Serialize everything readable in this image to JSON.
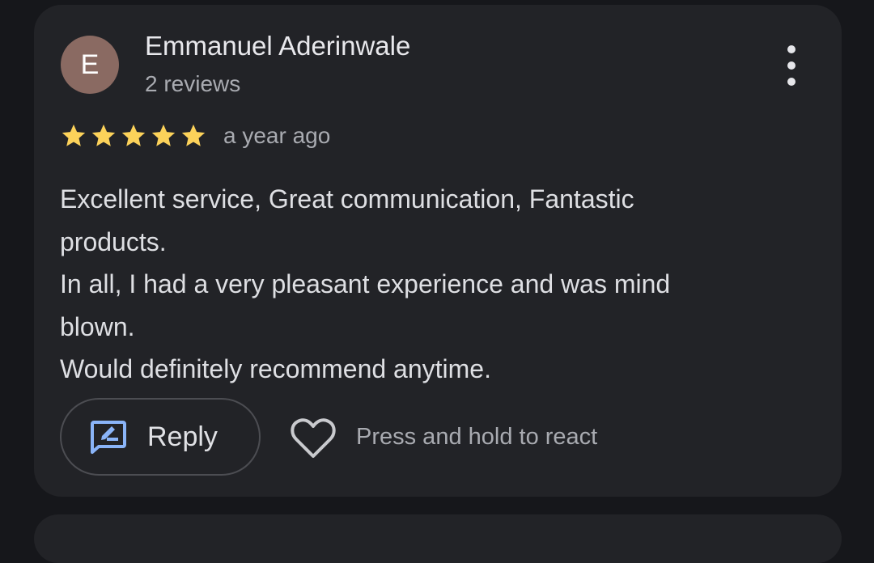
{
  "review": {
    "author_initial": "E",
    "author_name": "Emmanuel Aderinwale",
    "author_review_count": "2 reviews",
    "rating": 5,
    "rating_max": 5,
    "time_ago": "a year ago",
    "text_lines": [
      "Excellent service, Great communication, Fantastic products.",
      "In all, I had a very pleasant experience and was mind blown.",
      "Would definitely recommend anytime."
    ],
    "more_options_icon": "more-vert-icon"
  },
  "actions": {
    "reply_label": "Reply",
    "reply_icon": "rate-review-icon",
    "react_icon": "heart-outline-icon",
    "react_hint": "Press and hold to react"
  },
  "colors": {
    "background": "#16171b",
    "card": "#222327",
    "avatar": "#8a6a62",
    "star": "#fcd25a",
    "reply_icon": "#8ab4f8"
  }
}
